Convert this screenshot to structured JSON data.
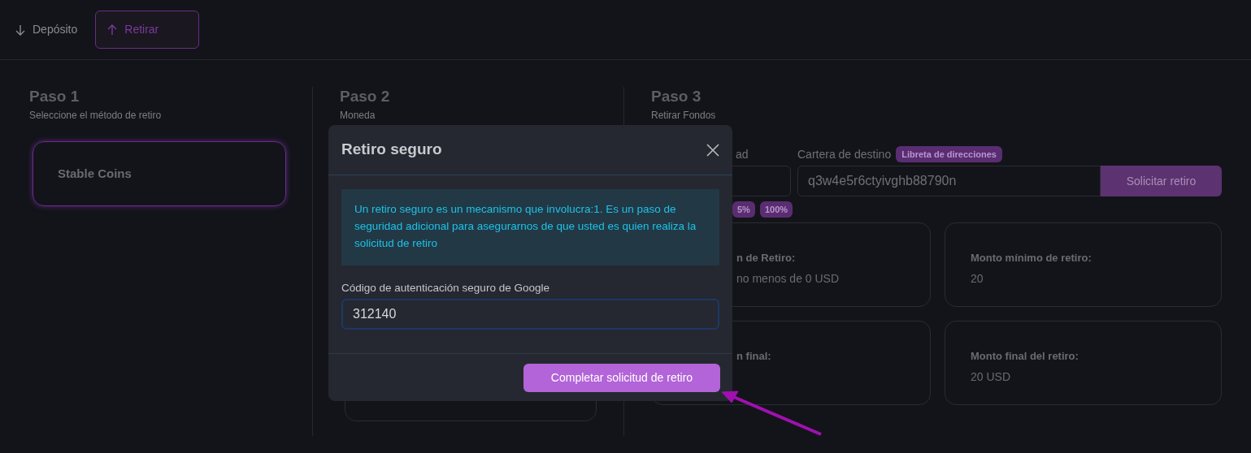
{
  "tabs": [
    {
      "label": "Depósito",
      "selected": false
    },
    {
      "label": "Retirar",
      "selected": true
    }
  ],
  "steps": [
    {
      "title": "Paso 1",
      "subtitle": "Seleccione el método de retiro"
    },
    {
      "title": "Paso 2",
      "subtitle": "Moneda"
    },
    {
      "title": "Paso 3",
      "subtitle": "Retirar Fondos"
    }
  ],
  "methods": [
    {
      "label": "Stable Coins",
      "selected": true
    }
  ],
  "withdraw_form": {
    "amount_label": "ad",
    "destination_label": "Cartera de destino",
    "address_book_badge": "Libreta de direcciones",
    "destination_value": "q3w4e5r6ctyivghb88790n",
    "request_button": "Solicitar retiro",
    "percent_buttons": [
      "5%",
      "100%"
    ]
  },
  "info_cards": [
    {
      "label": "n de Retiro:",
      "value": "no menos de 0 USD"
    },
    {
      "label": "Monto mínimo de retiro:",
      "value": "20"
    },
    {
      "label": "n final:"
    },
    {
      "label": "Monto final del retiro:",
      "value": "20 USD"
    }
  ],
  "modal": {
    "title": "Retiro seguro",
    "message": "Un retiro seguro es un mecanismo que involucra:1. Es un paso de seguridad adicional para asegurarnos de que usted es quien realiza la solicitud de retiro",
    "code_label": "Código de autenticación seguro de Google",
    "code_value": "312140",
    "submit_button": "Completar solicitud de retiro"
  }
}
